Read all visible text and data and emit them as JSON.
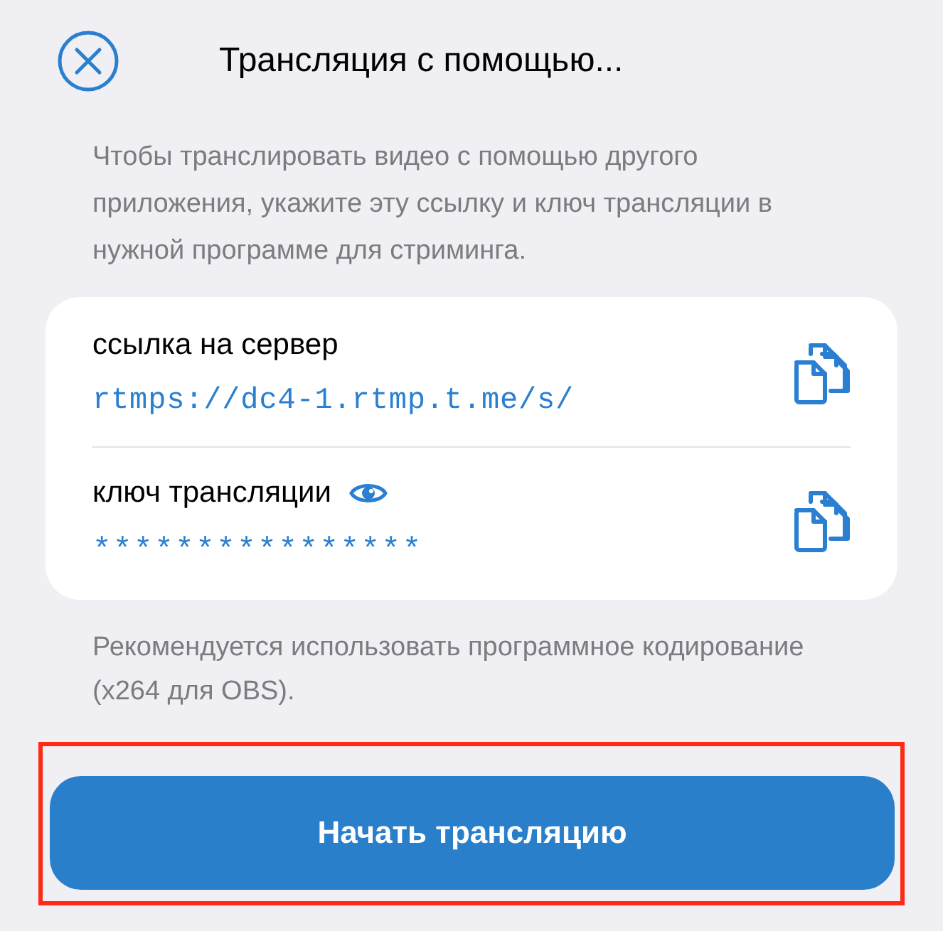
{
  "header": {
    "title": "Трансляция с помощью..."
  },
  "description": "Чтобы транслировать видео с помощью другого приложения, укажите эту ссылку и ключ трансляции в нужной программе для стриминга.",
  "fields": [
    {
      "kind": "url",
      "label": "ссылка на сервер",
      "value": "rtmps://dc4-1.rtmp.t.me/s/"
    },
    {
      "kind": "secret",
      "label": "ключ трансляции",
      "value": "****************"
    }
  ],
  "note": "Рекомендуется использовать программное кодирование (x264 для OBS).",
  "button": {
    "label": "Начать трансляцию",
    "highlighted": true
  }
}
